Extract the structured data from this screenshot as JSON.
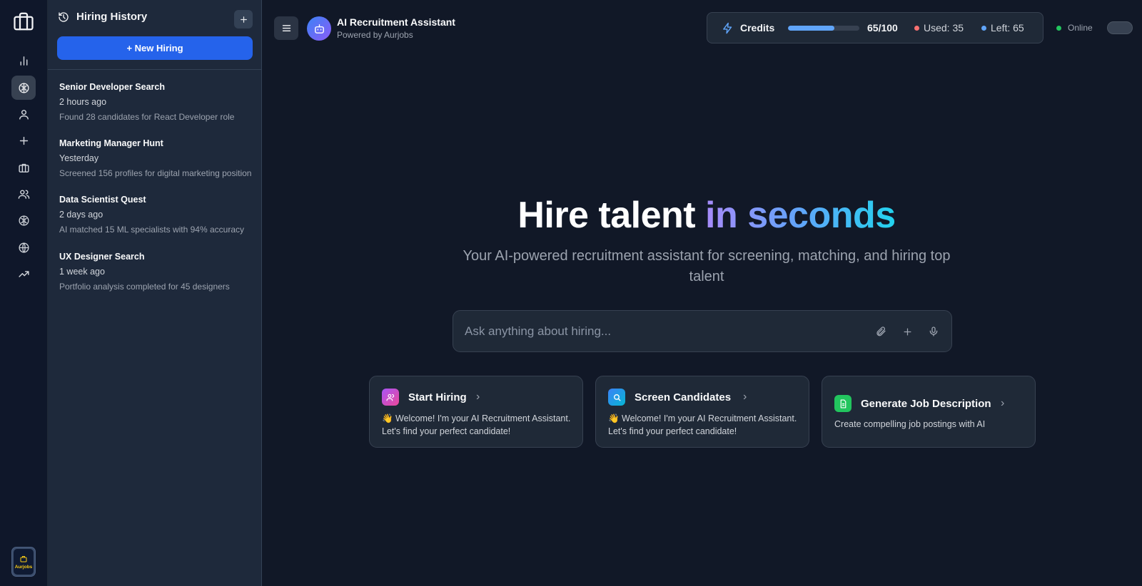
{
  "rail": {
    "items": [
      "chart-icon",
      "brain-icon",
      "user-icon",
      "plus-icon",
      "briefcase-icon",
      "users-icon",
      "brain-icon",
      "globe-icon",
      "trending-icon"
    ],
    "active_index": 1,
    "brand_label": "Aurjobs"
  },
  "history": {
    "title": "Hiring History",
    "new_button": "+ New Hiring",
    "items": [
      {
        "name": "Senior Developer Search",
        "time": "2 hours ago",
        "desc": "Found 28 candidates for React Developer role"
      },
      {
        "name": "Marketing Manager Hunt",
        "time": "Yesterday",
        "desc": "Screened 156 profiles for digital marketing position"
      },
      {
        "name": "Data Scientist Quest",
        "time": "2 days ago",
        "desc": "AI matched 15 ML specialists with 94% accuracy"
      },
      {
        "name": "UX Designer Search",
        "time": "1 week ago",
        "desc": "Portfolio analysis completed for 45 designers"
      }
    ]
  },
  "header": {
    "title": "AI Recruitment Assistant",
    "subtitle": "Powered by Aurjobs"
  },
  "credits": {
    "label": "Credits",
    "count": "65/100",
    "used_fraction": 0.65,
    "used": "Used: 35",
    "left": "Left: 65",
    "used_color": "#f87171",
    "left_color": "#60a5fa"
  },
  "status": {
    "label": "Online",
    "color": "#22c55e"
  },
  "hero": {
    "title_plain": "Hire talent ",
    "title_accent": "in seconds",
    "subtitle": "Your AI-powered recruitment assistant for screening, matching, and hiring top talent"
  },
  "ask": {
    "placeholder": "Ask anything about hiring..."
  },
  "cards": [
    {
      "title": "Start Hiring",
      "text": "👋 Welcome! I'm your AI Recruitment Assistant. Let's find your perfect candidate!"
    },
    {
      "title": "Screen Candidates",
      "text": "👋 Welcome! I'm your AI Recruitment Assistant. Let's find your perfect candidate!"
    },
    {
      "title": "Generate Job Description",
      "text": "Create compelling job postings with AI"
    }
  ]
}
